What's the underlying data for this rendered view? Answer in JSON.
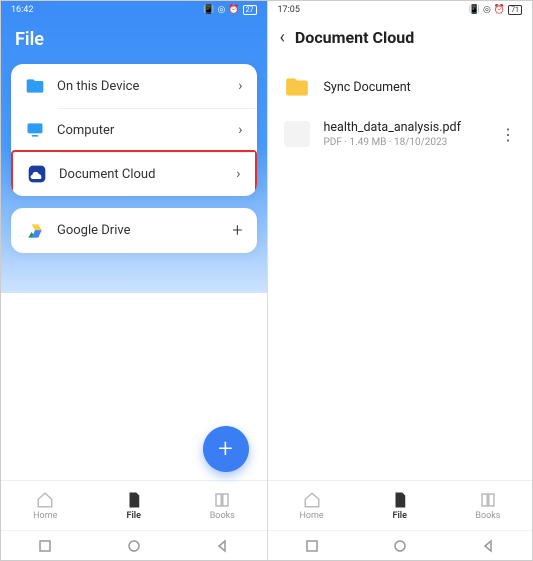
{
  "left": {
    "status": {
      "time": "16:42",
      "battery": "27"
    },
    "title": "File",
    "items": {
      "device": {
        "label": "On this Device"
      },
      "computer": {
        "label": "Computer"
      },
      "cloud": {
        "label": "Document Cloud"
      },
      "gdrive": {
        "label": "Google Drive"
      }
    },
    "tabs": {
      "home": "Home",
      "file": "File",
      "books": "Books"
    }
  },
  "right": {
    "status": {
      "time": "17:05",
      "battery": "71"
    },
    "title": "Document Cloud",
    "sync": {
      "label": "Sync Document"
    },
    "file": {
      "name": "health_data_analysis.pdf",
      "meta": "PDF · 1.49 MB · 18/10/2023"
    },
    "tabs": {
      "home": "Home",
      "file": "File",
      "books": "Books"
    }
  }
}
